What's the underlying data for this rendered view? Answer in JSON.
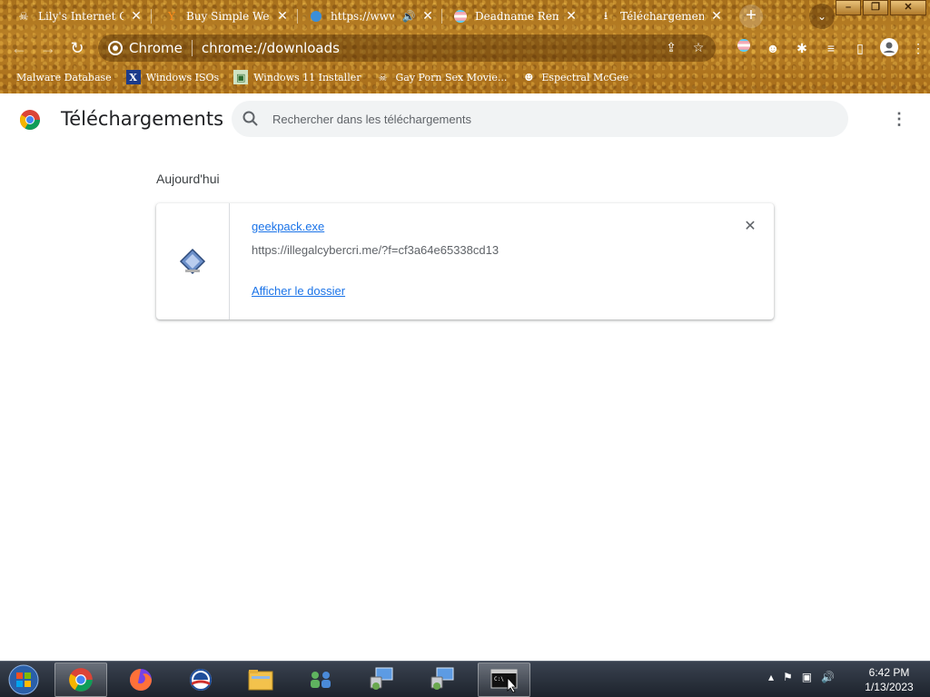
{
  "tabs": [
    {
      "title": "Lily's Internet Ca",
      "favicon": "skull-icon"
    },
    {
      "title": "Buy Simple Webs",
      "favicon": "fox-icon"
    },
    {
      "title": "https://www.",
      "favicon": "blue-drop-icon",
      "audio": true
    },
    {
      "title": "Deadname Remove",
      "favicon": "trans-flag-icon"
    },
    {
      "title": "Téléchargements",
      "favicon": "download-icon",
      "active": true
    }
  ],
  "window_controls": {
    "minimize": "–",
    "maximize": "❐",
    "close": "✕"
  },
  "omnibox": {
    "site_label": "Chrome",
    "url": "chrome://downloads"
  },
  "bookmarks": [
    {
      "label": "Malware Database",
      "icon": "none"
    },
    {
      "label": "Windows ISOs",
      "icon": "x-icon"
    },
    {
      "label": "Windows 11 Installer",
      "icon": "image-icon"
    },
    {
      "label": "Gay Porn Sex Movie...",
      "icon": "skull-icon"
    },
    {
      "label": "Espectral McGee",
      "icon": "face-icon"
    }
  ],
  "page": {
    "title": "Téléchargements",
    "search_placeholder": "Rechercher dans les téléchargements",
    "section_label": "Aujourd'hui"
  },
  "download": {
    "file_name": "geekpack.exe",
    "source_url": "https://illegalcybercri.me/?f=cf3a64e65338cd13",
    "show_folder_label": "Afficher le dossier"
  },
  "taskbar": {
    "apps": [
      "chrome",
      "firefox",
      "obama-logo",
      "file-explorer",
      "network-people",
      "remote-desktop-1",
      "remote-desktop-2",
      "command-prompt"
    ],
    "time": "6:42 PM",
    "date": "1/13/2023"
  },
  "colors": {
    "link": "#1a73e8",
    "frame": "#b07a24",
    "taskbar": "#1d232c"
  }
}
